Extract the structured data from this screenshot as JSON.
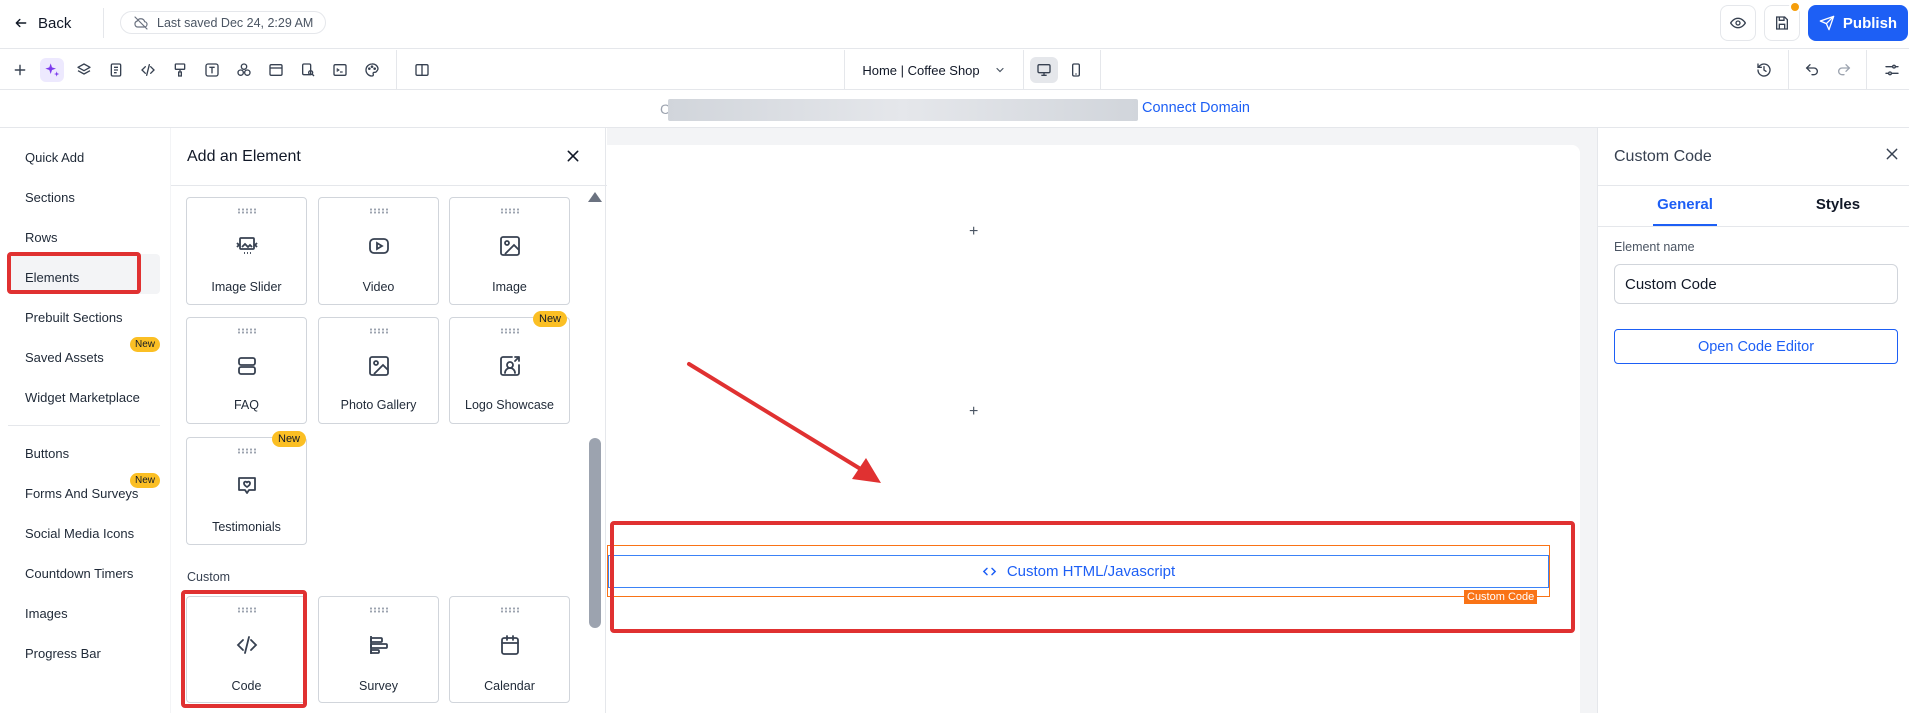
{
  "header": {
    "back_label": "Back",
    "saved_status": "Last saved Dec 24, 2:29 AM",
    "publish_label": "Publish"
  },
  "toolbar": {
    "page_name": "Home | Coffee Shop"
  },
  "domain_bar": {
    "prefix": "C",
    "connect_label": "Connect Domain"
  },
  "left_nav": {
    "items": [
      {
        "label": "Quick Add"
      },
      {
        "label": "Sections"
      },
      {
        "label": "Rows"
      },
      {
        "label": "Elements"
      },
      {
        "label": "Prebuilt Sections"
      },
      {
        "label": "Saved Assets",
        "badge": "New"
      },
      {
        "label": "Widget Marketplace"
      },
      {
        "label": "Buttons"
      },
      {
        "label": "Forms And Surveys",
        "badge": "New"
      },
      {
        "label": "Social Media Icons"
      },
      {
        "label": "Countdown Timers"
      },
      {
        "label": "Images"
      },
      {
        "label": "Progress Bar"
      }
    ]
  },
  "add_panel": {
    "title": "Add an Element",
    "cards": [
      {
        "label": "Image Slider",
        "icon": "image-slider-icon"
      },
      {
        "label": "Video",
        "icon": "video-icon"
      },
      {
        "label": "Image",
        "icon": "image-icon"
      },
      {
        "label": "FAQ",
        "icon": "faq-icon"
      },
      {
        "label": "Photo Gallery",
        "icon": "photo-gallery-icon"
      },
      {
        "label": "Logo Showcase",
        "icon": "logo-showcase-icon",
        "badge": "New"
      },
      {
        "label": "Testimonials",
        "icon": "testimonials-icon",
        "badge": "New"
      }
    ],
    "custom_heading": "Custom",
    "custom_cards": [
      {
        "label": "Code",
        "icon": "code-icon"
      },
      {
        "label": "Survey",
        "icon": "survey-icon"
      },
      {
        "label": "Calendar",
        "icon": "calendar-icon"
      }
    ]
  },
  "canvas": {
    "element_label": "Custom HTML/Javascript",
    "element_tag": "Custom Code"
  },
  "right_panel": {
    "title": "Custom Code",
    "tabs": [
      "General",
      "Styles"
    ],
    "element_name_label": "Element name",
    "element_name_value": "Custom Code",
    "open_editor_label": "Open Code Editor"
  },
  "colors": {
    "primary": "#1d5ff5",
    "badge": "#fbbf24",
    "annotation_red": "#e03131",
    "selection_orange": "#f97316"
  }
}
